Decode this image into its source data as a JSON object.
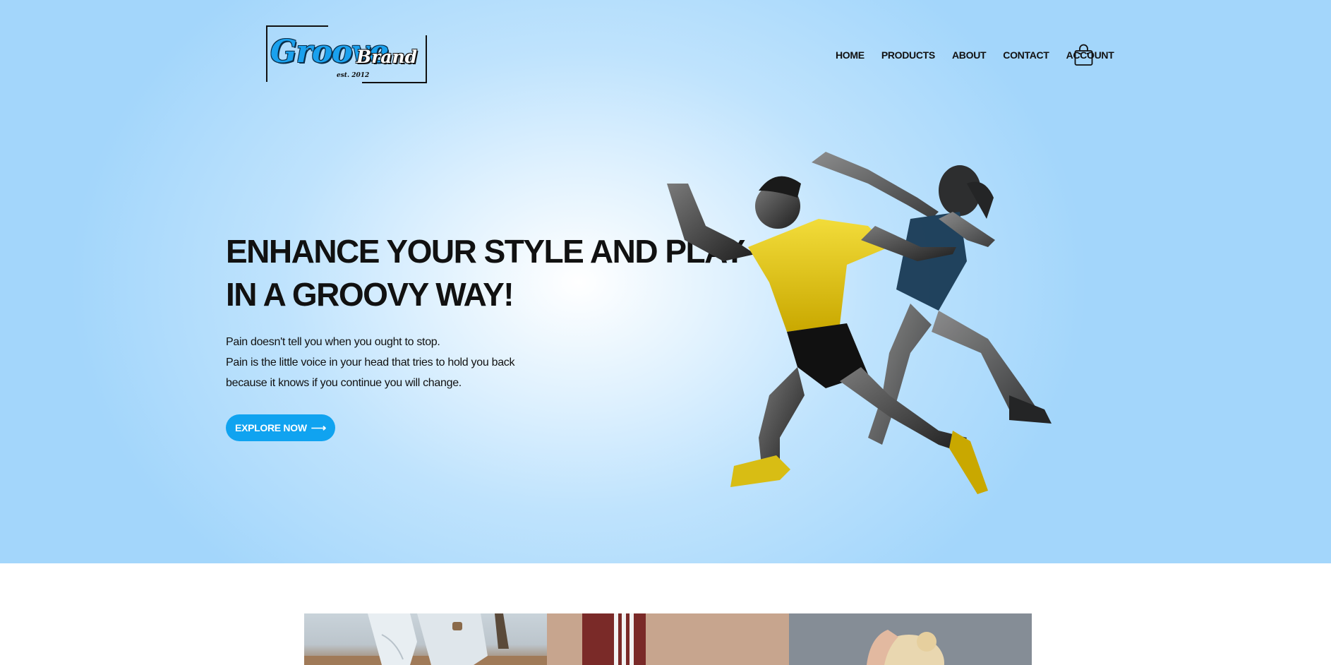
{
  "brand": {
    "script": "Groove",
    "name": "Brand",
    "est": "est. 2012"
  },
  "nav": {
    "items": [
      {
        "label": "HOME"
      },
      {
        "label": "PRODUCTS"
      },
      {
        "label": "ABOUT"
      },
      {
        "label": "CONTACT"
      },
      {
        "label": "ACCOUNT"
      }
    ],
    "cart_icon": "shopping-bag-icon"
  },
  "hero": {
    "headline_line1": "ENHANCE YOUR STYLE AND PLAY",
    "headline_line2": "IN A GROOVY WAY!",
    "body_line1": "Pain doesn't tell you when you ought to stop.",
    "body_line2": "Pain is the little voice in your head that tries to hold you back",
    "body_line3": "because it knows if you continue you will change.",
    "cta_label": "EXPLORE NOW",
    "cta_arrow": "⟶"
  },
  "colors": {
    "accent": "#10a3f0",
    "hero_bg": "#a3d6fb",
    "text": "#111111"
  }
}
